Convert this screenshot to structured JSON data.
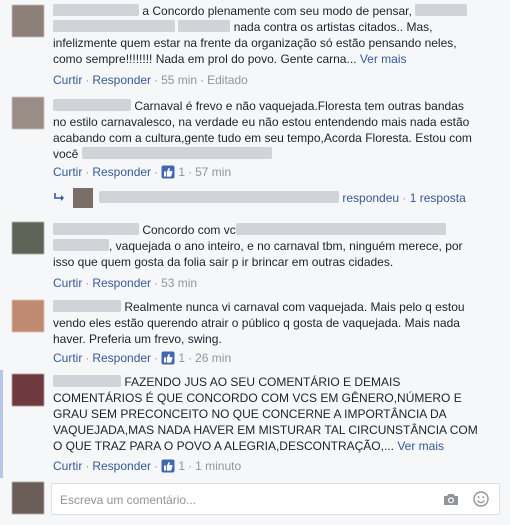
{
  "comments": [
    {
      "lines": [
        "a Concordo plenamente com seu modo de pensar,",
        "nada contra os artistas citados.. Mas,",
        "infelizmente quem estar na frente da organização só estão pensando neles,",
        "como sempre!!!!!!!! Nada em prol do povo. Gente carna..."
      ],
      "more": "Ver mais",
      "actions": {
        "like": "Curtir",
        "reply": "Responder",
        "time": "55 min",
        "edited": "Editado"
      }
    },
    {
      "lines": [
        "Carnaval é frevo e não vaquejada.Floresta tem outras bandas",
        "no estilo carnavalesco, na verdade eu não estou entendendo mais nada estão",
        "acabando com a cultura,gente tudo em seu tempo,Acorda Floresta. Estou com",
        "você"
      ],
      "actions": {
        "like": "Curtir",
        "reply": "Responder",
        "likes": "1",
        "time": "57 min"
      },
      "reply_summary": {
        "verb": "respondeu",
        "count": "1 resposta"
      }
    },
    {
      "lines": [
        "Concordo com vc",
        ", vaquejada o ano inteiro, e no carnaval tbm, ninguém merece, por",
        "isso que quem gosta da folia sair p ir brincar em outras cidades."
      ],
      "actions": {
        "like": "Curtir",
        "reply": "Responder",
        "time": "53 min"
      }
    },
    {
      "lines": [
        "Realmente nunca vi carnaval com vaquejada. Mais pelo q estou",
        "vendo eles estão querendo atrair o público q gosta de vaquejada. Mais nada",
        "haver. Preferia um frevo, swing."
      ],
      "actions": {
        "like": "Curtir",
        "reply": "Responder",
        "likes": "1",
        "time": "26 min"
      }
    },
    {
      "lines": [
        "FAZENDO JUS AO SEU COMENTÁRIO E DEMAIS",
        "COMENTÁRIOS É QUE CONCORDO COM VCS EM GÊNERO,NÚMERO E",
        "GRAU SEM PRECONCEITO NO QUE CONCERNE A IMPORTÂNCIA DA",
        "VAQUEJADA,MAS NADA HAVER EM MISTURAR TAL CIRCUNSTÂNCIA COM",
        "O QUE TRAZ PARA O POVO A ALEGRIA,DESCONTRAÇÃO,..."
      ],
      "more": "Ver mais",
      "actions": {
        "like": "Curtir",
        "reply": "Responder",
        "likes": "1",
        "time": "1 minuto"
      }
    }
  ],
  "compose": {
    "placeholder": "Escreva um comentário..."
  },
  "icons": {
    "like": "thumbs-up-icon",
    "camera": "camera-icon",
    "emoji": "smiley-icon",
    "reply": "reply-arrow-icon"
  },
  "colors": {
    "link": "#365899",
    "meta": "#90949c",
    "like_blue": "#4267b2"
  }
}
